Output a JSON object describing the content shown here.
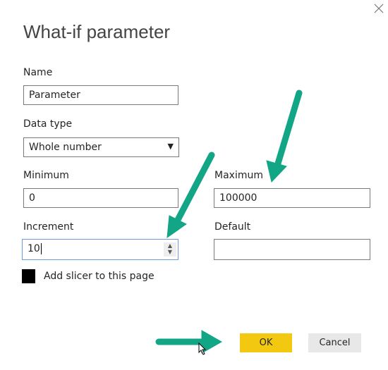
{
  "dialog": {
    "title": "What-if parameter",
    "close_icon": "close-icon"
  },
  "fields": {
    "name": {
      "label": "Name",
      "value": "Parameter"
    },
    "data_type": {
      "label": "Data type",
      "value": "Whole number"
    },
    "minimum": {
      "label": "Minimum",
      "value": "0"
    },
    "maximum": {
      "label": "Maximum",
      "value": "100000"
    },
    "increment": {
      "label": "Increment",
      "value": "10"
    },
    "default": {
      "label": "Default",
      "value": ""
    }
  },
  "checkbox": {
    "label": "Add slicer to this page",
    "checked": true
  },
  "buttons": {
    "ok": "OK",
    "cancel": "Cancel"
  },
  "colors": {
    "accent": "#F2C811",
    "arrow": "#12A586",
    "cancel_bg": "#E8E8E8"
  }
}
